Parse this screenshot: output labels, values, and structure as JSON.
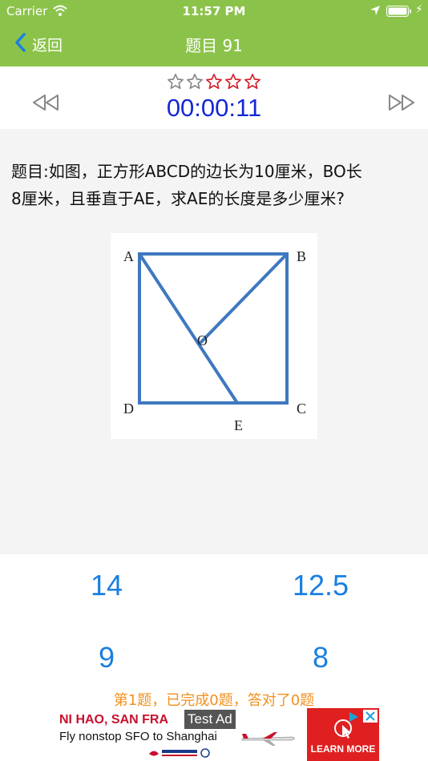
{
  "status_bar": {
    "carrier": "Carrier",
    "time": "11:57 PM"
  },
  "nav": {
    "back_label": "返回",
    "title": "题目 91"
  },
  "rating": {
    "value": 3,
    "max": 5,
    "colors": {
      "filled": "#d4202a",
      "empty": "#888888"
    }
  },
  "timer": {
    "value": "00:00:11",
    "color": "#1428d6"
  },
  "question": {
    "line1": "题目:如图，正方形ABCD的边长为10厘米，BO长",
    "line2": "8厘米，且垂直于AE，求AE的长度是多少厘米?"
  },
  "figure": {
    "labels": {
      "A": "A",
      "B": "B",
      "C": "C",
      "D": "D",
      "E": "E",
      "O": "O"
    },
    "line_color": "#3f78c0"
  },
  "answers": [
    "14",
    "12.5",
    "9",
    "8"
  ],
  "progress": "第1题，已完成0题，答对了0题",
  "ad": {
    "headline": "NI HAO, SAN FRA",
    "sub": "Fly nonstop SFO to Shanghai",
    "tag": "Test Ad",
    "cta": "LEARN MORE",
    "brand_color": "#c8102e"
  },
  "icons": [
    "wifi-icon",
    "location-icon",
    "battery-icon",
    "charging-icon",
    "back-chevron-icon",
    "star-icon",
    "previous-icon",
    "next-icon",
    "close-icon",
    "ad-choices-icon"
  ],
  "colors": {
    "nav_green": "#8bc34a",
    "answer_blue": "#1a7fe0",
    "progress_orange": "#f2901d"
  }
}
